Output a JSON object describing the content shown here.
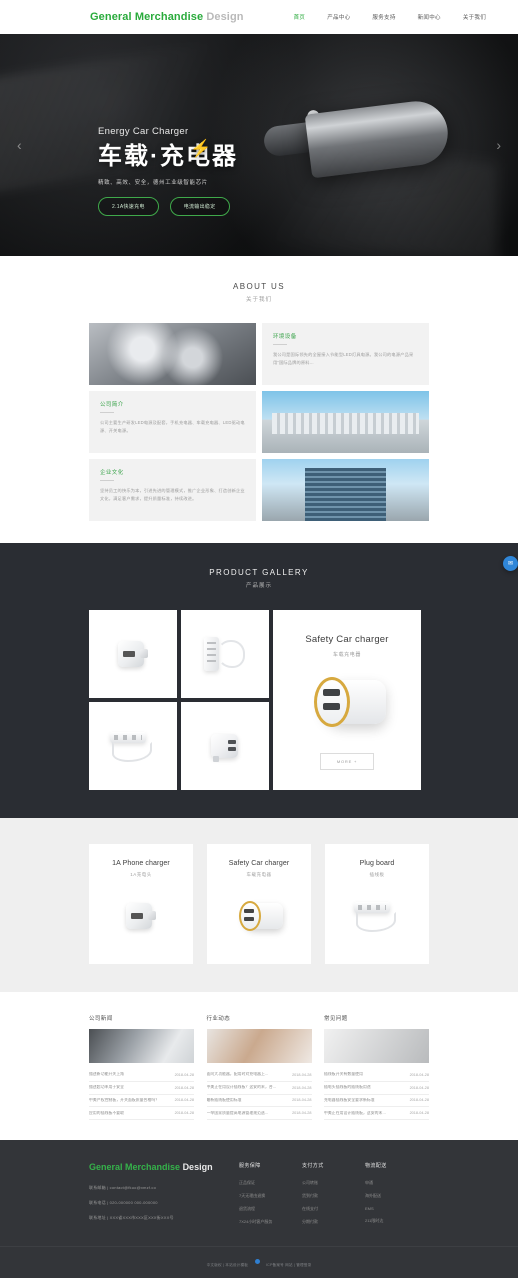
{
  "header": {
    "logo_primary": "General Merchandise",
    "logo_secondary": "Design",
    "nav": [
      {
        "label": "首页",
        "active": true
      },
      {
        "label": "产品中心",
        "active": false
      },
      {
        "label": "服务支持",
        "active": false
      },
      {
        "label": "新闻中心",
        "active": false
      },
      {
        "label": "关于我们",
        "active": false
      }
    ]
  },
  "hero": {
    "eyebrow": "Energy Car Charger",
    "title": "车载·充电器",
    "subtitle": "精致、高效、安全，德州工业级智能芯片",
    "buttons": [
      "2.1A快速充电",
      "电流输出稳定"
    ],
    "arrow_left": "‹",
    "arrow_right": "›"
  },
  "about": {
    "heading_en": "ABOUT US",
    "heading_cn": "关于我们",
    "tiles": [
      {
        "kind": "image",
        "art": "industrial"
      },
      {
        "kind": "text",
        "title": "环境设备",
        "body": "我公司是国际领先的全屋接入节能型LED灯具电源。我公司的电源产品采用“国际品牌的原料..."
      },
      {
        "kind": "image",
        "art": "buildings"
      },
      {
        "kind": "text",
        "title": "公司简介",
        "body": "公司主要生产研发LED电源及配套，手机充电器、车载充电器、LED驱动电源、开关电源。"
      },
      {
        "kind": "text",
        "title": "企业文化",
        "body": "坚持员工的快乐为本，引进先进的管理模式，推广企业形象、打造创新企业文化，满足客户需求，提升质量标准，持续改进。"
      },
      {
        "kind": "image",
        "art": "tower"
      }
    ]
  },
  "gallery": {
    "heading_en": "PRODUCT GALLERY",
    "heading_cn": "产品展示",
    "cells": [
      {
        "art": "plug-a"
      },
      {
        "art": "strip"
      },
      {
        "art": "strip4"
      },
      {
        "art": "adapter"
      }
    ],
    "feature": {
      "title": "Safety Car charger",
      "subtitle": "车载充电器",
      "more_label": "MORE +"
    }
  },
  "cards": [
    {
      "title": "1A Phone charger",
      "subtitle": "1A充电头",
      "art": "plug-a"
    },
    {
      "title": "Safety Car charger",
      "subtitle": "车载充电器",
      "art": "car"
    },
    {
      "title": "Plug board",
      "subtitle": "插线板",
      "art": "strip4"
    }
  ],
  "news": [
    {
      "heading": "公司新闻",
      "art": "a",
      "items": [
        {
          "title": "描述新功能开关上角",
          "date": "2018-04-28"
        },
        {
          "title": "描述超功率用于安全",
          "date": "2018-04-28"
        },
        {
          "title": "中美产权控制板，开关面板质量合格吗？",
          "date": "2018-04-28"
        },
        {
          "title": "应用的插线板不要取",
          "date": "2018-04-28"
        }
      ]
    },
    {
      "heading": "行业动态",
      "art": "b",
      "items": [
        {
          "title": "面向大功能器，配用时对充电器上...",
          "date": "2018-04-28"
        },
        {
          "title": "中美正在用设计插线板？这安的末，合...",
          "date": "2018-04-28"
        },
        {
          "title": "最新插线板使用标准",
          "date": "2018-04-28"
        },
        {
          "title": "一举国家质量提高电源管理规范选...",
          "date": "2018-04-28"
        }
      ]
    },
    {
      "heading": "常见问题",
      "art": "c",
      "items": [
        {
          "title": "插线板开关有数量使用",
          "date": "2018-04-28"
        },
        {
          "title": "插电头插线板的插线板用途",
          "date": "2018-04-28"
        },
        {
          "title": "充电器插线板安全要求新标准",
          "date": "2018-04-28"
        },
        {
          "title": "中美正在用设计插线板，这安的末...",
          "date": "2018-04-28"
        }
      ]
    }
  ],
  "footer": {
    "logo_primary": "General Merchandise",
    "logo_secondary": "Design",
    "contacts": [
      "联系邮箱 | contact@fkuo@xmzf.co",
      "联系电话 | 020-000000  000-000000",
      "联系地址 | XXX省XXX市XXX区XXX街XXX号"
    ],
    "columns": [
      {
        "heading": "服务保障",
        "links": [
          "正品保证",
          "7天无理由退换",
          "退货流程",
          "7X24小时客户服务"
        ]
      },
      {
        "heading": "支付方式",
        "links": [
          "公司转账",
          "货到付款",
          "在线支付",
          "分期付款"
        ]
      },
      {
        "heading": "物流配送",
        "links": [
          "申通",
          "海外配送",
          "EMS",
          "211限时达"
        ]
      }
    ],
    "copyright": "中文版权 | 本站设计模板",
    "copyright_tail": "ICP备案号  网站 | 管理登录"
  },
  "float_widget": {
    "icon": "chat-icon",
    "glyph": "✉"
  },
  "colors": {
    "brand_green": "#2aab3c",
    "dark_panel": "#2a2d33",
    "footer_bg": "#333539",
    "widget_blue": "#2f86d8"
  }
}
